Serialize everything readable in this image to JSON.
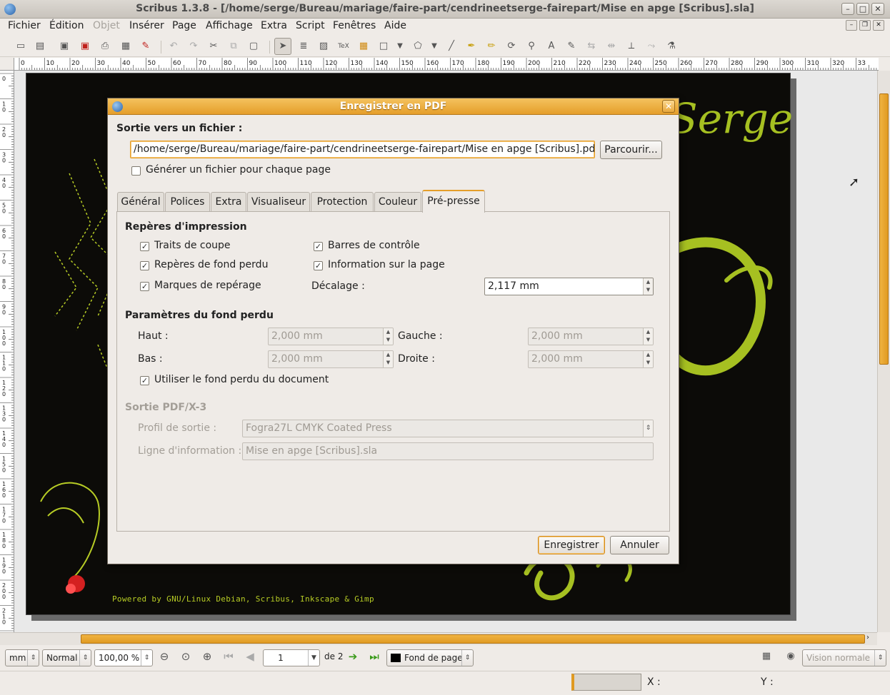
{
  "window": {
    "title": "Scribus 1.3.8 - [/home/serge/Bureau/mariage/faire-part/cendrineetserge-fairepart/Mise en apge [Scribus].sla]",
    "minimize": "–",
    "maximize": "□",
    "close": "✕"
  },
  "menu": {
    "items": [
      "Fichier",
      "Édition",
      "Objet",
      "Insérer",
      "Page",
      "Affichage",
      "Extra",
      "Script",
      "Fenêtres",
      "Aide"
    ],
    "disabled": [
      "Objet"
    ]
  },
  "toolbar": {
    "icons": [
      "new-icon",
      "open-icon",
      "save-icon",
      "close-doc-icon",
      "print-icon",
      "preflight-icon",
      "pdf-icon",
      "undo-icon",
      "redo-icon",
      "cut-icon",
      "copy-icon",
      "paste-icon",
      "select-icon",
      "text-frame-icon",
      "image-frame-icon",
      "latex-frame-icon",
      "table-icon",
      "shape-icon",
      "polygon-icon",
      "line-icon",
      "bezier-icon",
      "freehand-icon",
      "rotate-icon",
      "zoom-icon",
      "edit-text-icon",
      "story-editor-icon",
      "link-frames-icon",
      "unlink-frames-icon",
      "measure-icon",
      "copy-props-icon",
      "eyedropper-icon"
    ]
  },
  "ruler": {
    "h_labels": [
      "0",
      "10",
      "20",
      "30",
      "40",
      "50",
      "60",
      "70",
      "80",
      "90",
      "100",
      "110",
      "120",
      "130",
      "140",
      "150",
      "160",
      "170",
      "180",
      "190",
      "200",
      "210",
      "220",
      "230",
      "240",
      "250",
      "260",
      "270",
      "280",
      "290",
      "300",
      "310",
      "320",
      "33"
    ],
    "v_labels": [
      "0",
      "10",
      "20",
      "30",
      "40",
      "50",
      "60",
      "70",
      "80",
      "90",
      "100",
      "110",
      "120",
      "130",
      "140",
      "150",
      "160",
      "170",
      "180",
      "190",
      "200",
      "210"
    ]
  },
  "canvas": {
    "page_title_text": "Serge",
    "powered_text": "Powered by GNU/Linux Debian, Scribus, Inkscape & Gimp"
  },
  "dialog": {
    "title": "Enregistrer en PDF",
    "output_label": "Sortie vers un fichier :",
    "output_path": "/home/serge/Bureau/mariage/faire-part/cendrineetserge-fairepart/Mise en apge [Scribus].pdf",
    "browse_button": "Parcourir...",
    "per_page_label": "Générer un fichier pour chaque page",
    "per_page_checked": false,
    "tabs": [
      "Général",
      "Polices",
      "Extra",
      "Visualiseur",
      "Protection",
      "Couleur",
      "Pré-presse"
    ],
    "active_tab": "Pré-presse",
    "prepress": {
      "marks_heading": "Repères d'impression",
      "crop_marks": "Traits de coupe",
      "bleed_marks": "Repères de fond perdu",
      "registration_marks": "Marques de repérage",
      "color_bars": "Barres de contrôle",
      "page_info": "Information sur la page",
      "offset_label": "Décalage :",
      "offset_value": "2,117 mm",
      "bleed_heading": "Paramètres du fond perdu",
      "top_label": "Haut :",
      "top_value": "2,000 mm",
      "bottom_label": "Bas :",
      "bottom_value": "2,000 mm",
      "left_label": "Gauche :",
      "left_value": "2,000 mm",
      "right_label": "Droite :",
      "right_value": "2,000 mm",
      "use_doc_bleed": "Utiliser le fond perdu du document",
      "pdfx_heading": "Sortie PDF/X-3",
      "output_profile_label": "Profil de sortie :",
      "output_profile_value": "Fogra27L CMYK Coated Press",
      "info_line_label": "Ligne d'information :",
      "info_line_value": "Mise en apge [Scribus].sla"
    },
    "save_button": "Enregistrer",
    "cancel_button": "Annuler",
    "check_mark": "✓"
  },
  "bottombar": {
    "unit": "mm",
    "mode": "Normal",
    "zoom": "100,00 %",
    "page_number": "1",
    "page_of": "de 2",
    "layer": "Fond de page",
    "view_mode": "Vision normale"
  },
  "statusbar": {
    "x_label": "X :",
    "y_label": "Y :"
  },
  "colors": {
    "accent": "#e59e2a",
    "page_bg": "#0c0b08",
    "artwork_green": "#a6c021"
  }
}
